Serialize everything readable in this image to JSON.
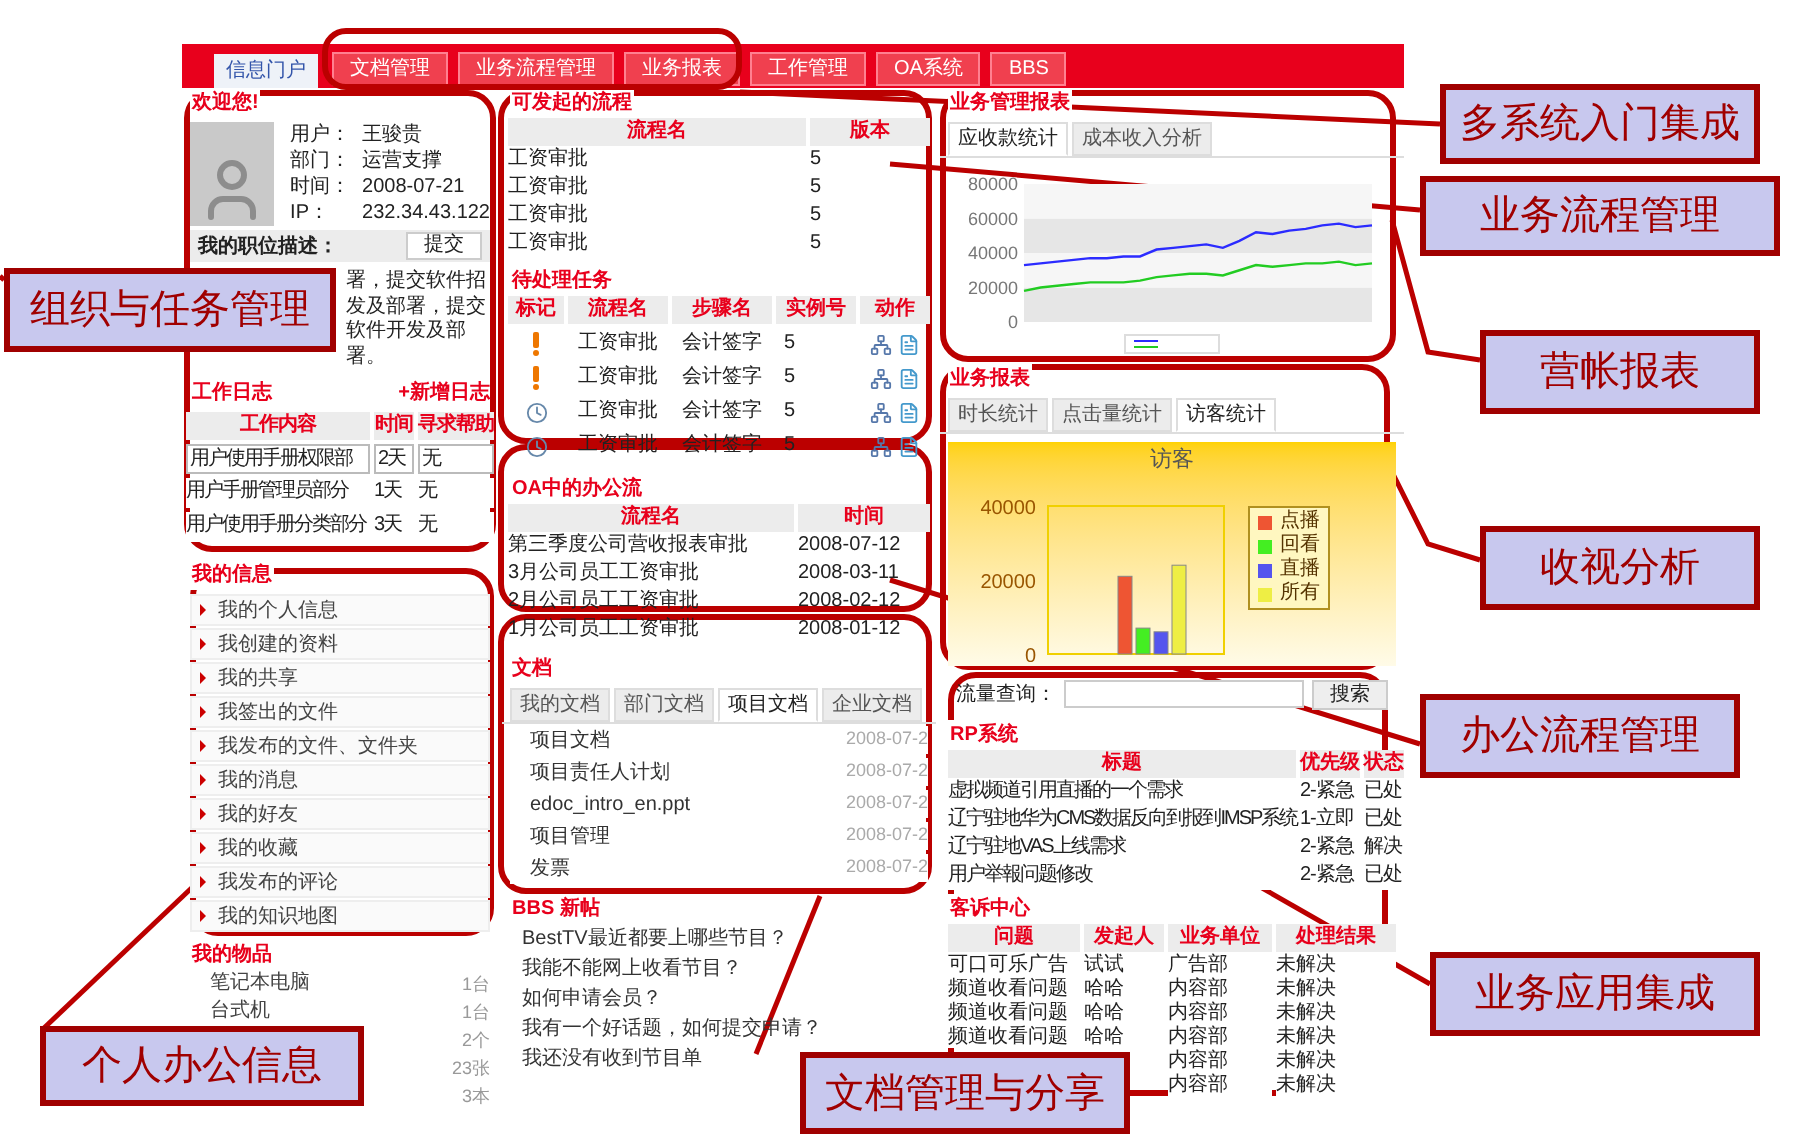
{
  "tabs": [
    {
      "label": "信息门户",
      "selected": true
    },
    {
      "label": "文档管理",
      "selected": false
    },
    {
      "label": "业务流程管理",
      "selected": false
    },
    {
      "label": "业务报表",
      "selected": false
    },
    {
      "label": "工作管理",
      "selected": false
    },
    {
      "label": "OA系统",
      "selected": false
    },
    {
      "label": "BBS",
      "selected": false
    }
  ],
  "user_panel": {
    "title": "欢迎您!",
    "fields": [
      {
        "label": "用户：",
        "value": "王骏贵"
      },
      {
        "label": "部门：",
        "value": "运营支撑"
      },
      {
        "label": "时间：",
        "value": "2008-07-21"
      },
      {
        "label": "IP：",
        "value": "232.34.43.122"
      }
    ],
    "duty_label": "我的职位描述：",
    "submit_button": "提交",
    "duty_lines": [
      "署，提交软件招",
      "发及部署，提交",
      "软件开发及部",
      "署。"
    ]
  },
  "work_log": {
    "title": "工作日志",
    "add_link": "+新增日志",
    "columns": [
      "工作内容",
      "时间",
      "寻求帮助"
    ],
    "rows": [
      {
        "kind": "input",
        "cells": [
          "用户使用手册权限部",
          "2天",
          "无"
        ]
      },
      {
        "kind": "text",
        "cells": [
          "用户手册管理员部分",
          "1天",
          "无"
        ]
      },
      {
        "kind": "text",
        "cells": [
          "用户使用手册分类部分",
          "3天",
          "无"
        ]
      }
    ]
  },
  "my_info": {
    "title": "我的信息",
    "items": [
      "我的个人信息",
      "我创建的资料",
      "我的共享",
      "我签出的文件",
      "我发布的文件、文件夹",
      "我的消息",
      "我的好友",
      "我的收藏",
      "我发布的评论",
      "我的知识地图"
    ]
  },
  "my_assets": {
    "title": "我的物品",
    "items": [
      {
        "label": "笔记本电脑",
        "count": "1台"
      },
      {
        "label": "台式机",
        "count": "1台"
      },
      {
        "count": "2个"
      },
      {
        "count": "23张"
      },
      {
        "count": "3本"
      }
    ]
  },
  "flows": {
    "title": "可发起的流程",
    "columns": [
      "流程名",
      "版本"
    ],
    "rows": [
      [
        "工资审批",
        "5"
      ],
      [
        "工资审批",
        "5"
      ],
      [
        "工资审批",
        "5"
      ],
      [
        "工资审批",
        "5"
      ]
    ]
  },
  "tasks": {
    "title": "待处理任务",
    "columns": [
      "标记",
      "流程名",
      "步骤名",
      "实例号",
      "动作"
    ],
    "rows": [
      {
        "kind": "alert",
        "flow": "工资审批",
        "step": "会计签字",
        "instance": "5"
      },
      {
        "kind": "alert",
        "flow": "工资审批",
        "step": "会计签字",
        "instance": "5"
      },
      {
        "kind": "clock",
        "flow": "工资审批",
        "step": "会计签字",
        "instance": "5"
      },
      {
        "kind": "clock",
        "flow": "工资审批",
        "step": "会计签字",
        "instance": "5"
      }
    ]
  },
  "oa": {
    "title": "OA中的办公流",
    "columns": [
      "流程名",
      "时间"
    ],
    "rows": [
      [
        "第三季度公司营收报表审批",
        "2008-07-12"
      ],
      [
        "3月公司员工工资审批",
        "2008-03-11"
      ],
      [
        "2月公司员工工资审批",
        "2008-02-12"
      ],
      [
        "1月公司员工工资审批",
        "2008-01-12"
      ]
    ]
  },
  "docs": {
    "title": "文档",
    "tabs": [
      {
        "label": "我的文档",
        "selected": false
      },
      {
        "label": "部门文档",
        "selected": false
      },
      {
        "label": "项目文档",
        "selected": true
      },
      {
        "label": "企业文档",
        "selected": false
      }
    ],
    "items": [
      {
        "name": "项目文档",
        "date": "2008-07-2"
      },
      {
        "name": "项目责任人计划",
        "date": "2008-07-2"
      },
      {
        "name": "edoc_intro_en.ppt",
        "date": "2008-07-2"
      },
      {
        "name": "项目管理",
        "date": "2008-07-2"
      },
      {
        "name": "发票",
        "date": "2008-07-2"
      }
    ]
  },
  "bbs": {
    "title": "BBS 新帖",
    "items": [
      "BestTV最近都要上哪些节目？",
      "我能不能网上收看节目？",
      "如何申请会员？",
      "我有一个好话题，如何提交申请？",
      "我还没有收到节目单"
    ]
  },
  "mgmt_report": {
    "title": "业务管理报表",
    "tabs": [
      {
        "label": "应收款统计",
        "selected": true
      },
      {
        "label": "成本收入分析",
        "selected": false
      }
    ],
    "chart_data": {
      "type": "line",
      "ylim": [
        0,
        80000
      ],
      "yticks": [
        0,
        20000,
        40000,
        60000,
        80000
      ],
      "series": [
        {
          "color": "#2b2bff",
          "values": [
            33000,
            34000,
            35000,
            36000,
            37000,
            37000,
            38000,
            38000,
            42000,
            43000,
            44000,
            45000,
            43000,
            47000,
            52000,
            51000,
            53000,
            54000,
            56000,
            57000,
            55000,
            56000
          ]
        },
        {
          "color": "#22cc22",
          "values": [
            18000,
            20000,
            21000,
            22000,
            23000,
            23000,
            23000,
            24000,
            26000,
            27000,
            28000,
            28000,
            27000,
            30000,
            33000,
            32000,
            33000,
            34000,
            34000,
            35000,
            33000,
            34000
          ]
        }
      ]
    }
  },
  "biz_report": {
    "title": "业务报表",
    "tabs": [
      {
        "label": "时长统计",
        "selected": false
      },
      {
        "label": "点击量统计",
        "selected": false
      },
      {
        "label": "访客统计",
        "selected": true
      }
    ],
    "chart_data": {
      "type": "bar",
      "title": "访客",
      "legend": "right",
      "ylim": [
        0,
        40000
      ],
      "yticks": [
        0,
        20000,
        40000
      ],
      "series": [
        {
          "name": "点播",
          "color": "#ee5533",
          "values": [
            21000
          ]
        },
        {
          "name": "回看",
          "color": "#44ee22",
          "values": [
            7000
          ]
        },
        {
          "name": "直播",
          "color": "#5555ee",
          "values": [
            6000
          ]
        },
        {
          "name": "所有",
          "color": "#eeee44",
          "values": [
            24000
          ]
        }
      ]
    }
  },
  "search": {
    "label": "流量查询：",
    "button": "搜索"
  },
  "rp": {
    "title": "RP系统",
    "columns": [
      "标题",
      "优先级",
      "状态"
    ],
    "rows": [
      [
        "虚拟频道引用直播的一个需求",
        "2-紧急",
        "已处"
      ],
      [
        "辽宁驻地华为CMS数据反向到报到IMSP系统",
        "1-立即",
        "已处"
      ],
      [
        "辽宁驻地VAS上线需求",
        "2-紧急",
        "解决"
      ],
      [
        "用户举報问题修改",
        "2-紧急",
        "已处"
      ]
    ]
  },
  "complaints": {
    "title": "客诉中心",
    "columns": [
      "问题",
      "发起人",
      "业务单位",
      "处理结果"
    ],
    "rows": [
      [
        "可口可乐广告",
        "试试",
        "广告部",
        "未解决"
      ],
      [
        "频道收看问题",
        "哈哈",
        "内容部",
        "未解决"
      ],
      [
        "频道收看问题",
        "哈哈",
        "内容部",
        "未解决"
      ],
      [
        "频道收看问题",
        "哈哈",
        "内容部",
        "未解决"
      ],
      [
        null,
        null,
        "内容部",
        "未解决"
      ],
      [
        null,
        null,
        "内容部",
        "未解决"
      ]
    ]
  },
  "callouts": [
    "多系统入门集成",
    "业务流程管理",
    "营帐报表",
    "收视分析",
    "办公流程管理",
    "业务应用集成",
    "组织与任务管理",
    "个人办公信息",
    "文档管理与分享"
  ]
}
